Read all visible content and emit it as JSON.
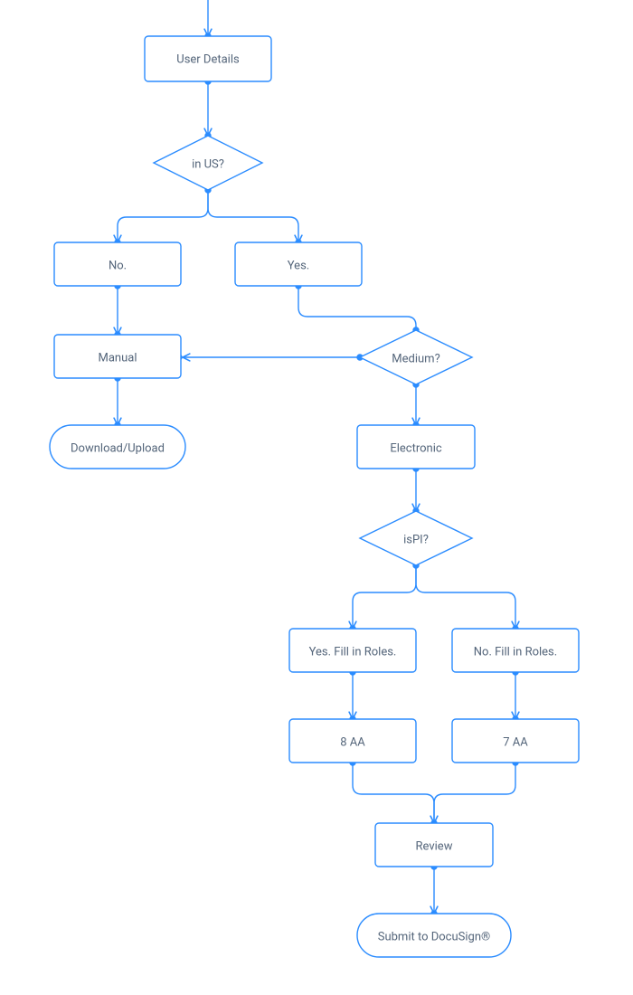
{
  "colors": {
    "stroke": "#2b8cff",
    "bg": "#ffffff",
    "text": "#54657a"
  },
  "nodes": {
    "user_details": "User Details",
    "in_us": "in US?",
    "no": "No.",
    "yes": "Yes.",
    "manual": "Manual",
    "download_upload": "Download/Upload",
    "medium": "Medium?",
    "electronic": "Electronic",
    "is_pi": "isPI?",
    "yes_roles": "Yes. Fill in Roles.",
    "no_roles": "No. Fill in Roles.",
    "eight_aa": "8 AA",
    "seven_aa": "7 AA",
    "review": "Review",
    "submit": "Submit to DocuSign®"
  }
}
